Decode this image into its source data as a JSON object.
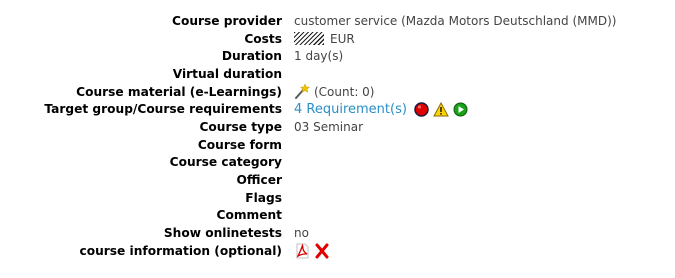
{
  "fields": [
    {
      "label": "Course provider",
      "value": "customer service (Mazda Motors Deutschland (MMD))"
    },
    {
      "label": "Costs",
      "value": "EUR"
    },
    {
      "label": "Duration",
      "value": "1 day(s)"
    },
    {
      "label": "Virtual duration",
      "value": ""
    },
    {
      "label": "Course material (e-Learnings)",
      "value": "(Count: 0)"
    },
    {
      "label": "Target group/Course requirements",
      "value": "4 Requirement(s)"
    },
    {
      "label": "Course type",
      "value": "03 Seminar"
    },
    {
      "label": "Course form",
      "value": ""
    },
    {
      "label": "Course category",
      "value": ""
    },
    {
      "label": "Officer",
      "value": ""
    },
    {
      "label": "Flags",
      "value": ""
    },
    {
      "label": "Comment",
      "value": ""
    },
    {
      "label": "Show onlinetests",
      "value": "no"
    },
    {
      "label": "course information (optional)",
      "value": ""
    }
  ],
  "icons": {
    "elearning": "wand-icon",
    "requirements_status": [
      "red-circle-icon",
      "warning-triangle-icon",
      "green-play-icon"
    ],
    "course_info": [
      "pdf-icon",
      "delete-x-icon"
    ]
  },
  "colors": {
    "link": "#2a8fc8",
    "status_red": "#e00000",
    "status_yellow": "#ffd400",
    "status_green": "#1aa11a",
    "delete_red": "#e00000"
  }
}
